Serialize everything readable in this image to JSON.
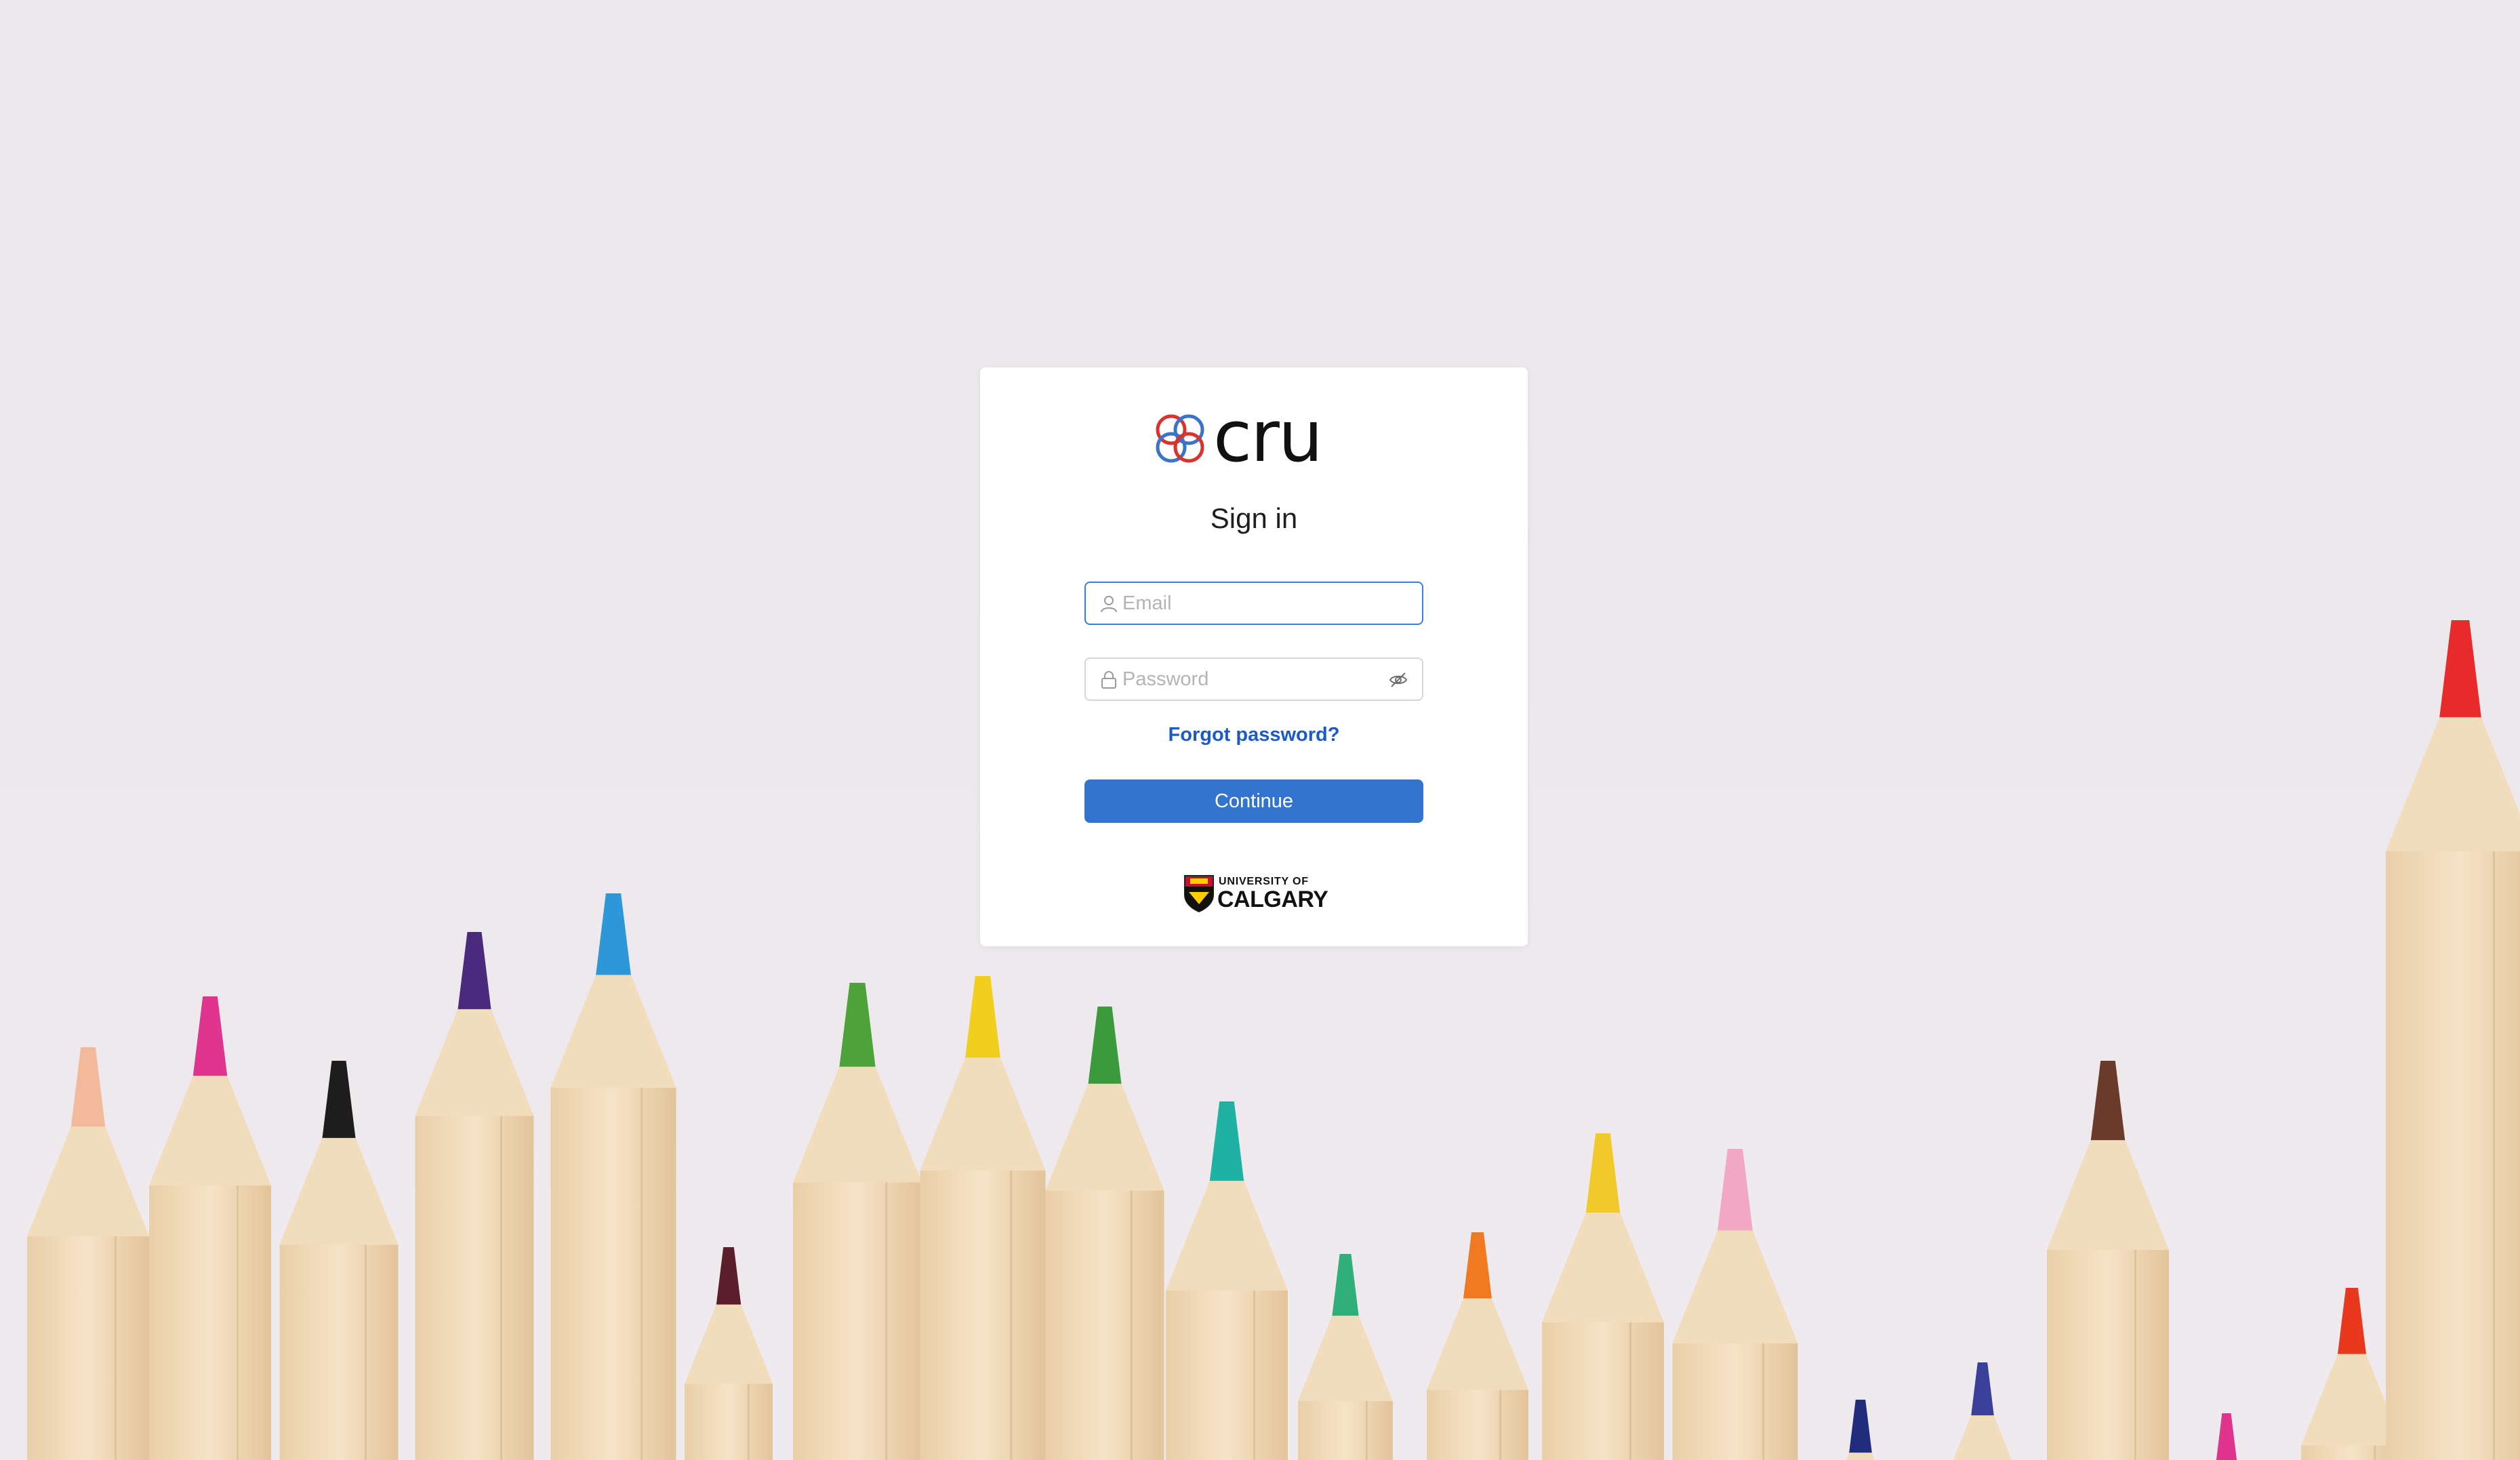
{
  "page": {
    "background_color": "#ece8ec"
  },
  "brand": {
    "logo_text": "cru",
    "logo_icon": "cru-knot-icon",
    "colors": {
      "red": "#d9322f",
      "blue": "#3b73c9"
    }
  },
  "signin": {
    "title": "Sign in",
    "email": {
      "value": "",
      "placeholder": "Email",
      "icon": "user-icon"
    },
    "password": {
      "value": "",
      "placeholder": "Password",
      "icon": "lock-icon",
      "toggle_icon": "eye-slash-icon"
    },
    "forgot_password_label": "Forgot password?",
    "continue_label": "Continue",
    "accent_color": "#3374cf",
    "link_color": "#1a5bc7"
  },
  "footer_logo": {
    "line1": "UNIVERSITY OF",
    "line2": "CALGARY",
    "icon": "university-shield-icon"
  }
}
